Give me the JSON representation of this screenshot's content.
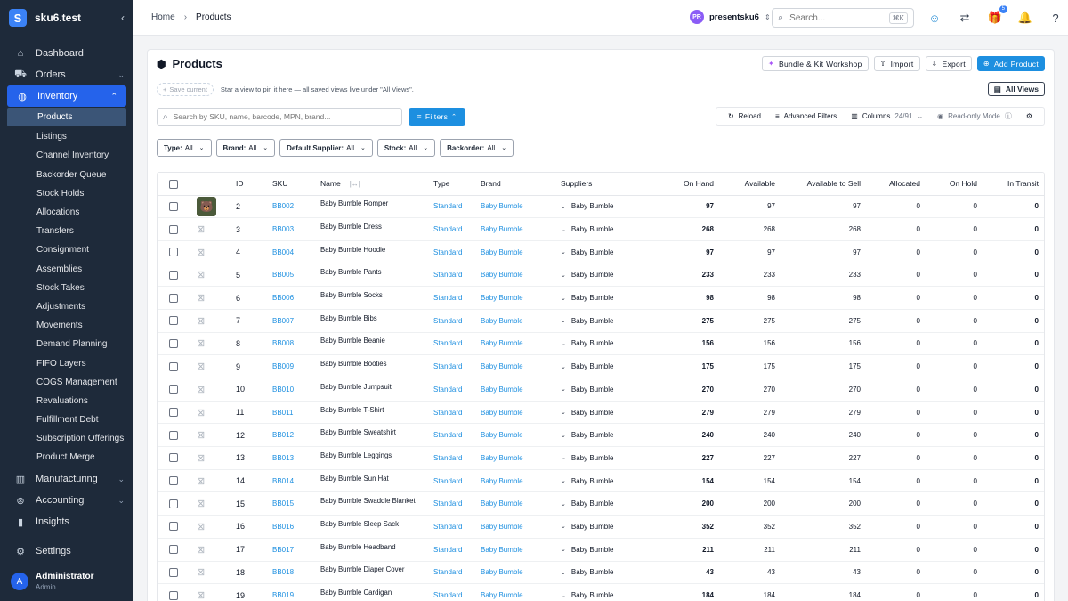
{
  "sidebar": {
    "site": "sku6.test",
    "logo_letter": "S",
    "items": [
      {
        "label": "Dashboard",
        "icon": "dashboard-icon"
      },
      {
        "label": "Orders",
        "icon": "cart-icon",
        "expandable": true
      },
      {
        "label": "Inventory",
        "icon": "globe-icon",
        "expandable": true,
        "active": true
      }
    ],
    "inventory_sub": [
      "Products",
      "Listings",
      "Channel Inventory",
      "Backorder Queue",
      "Stock Holds",
      "Allocations",
      "Transfers",
      "Consignment",
      "Assemblies",
      "Stock Takes",
      "Adjustments",
      "Movements",
      "Demand Planning",
      "FIFO Layers",
      "COGS Management",
      "Revaluations",
      "Fulfillment Debt",
      "Subscription Offerings",
      "Product Merge"
    ],
    "lower_items": [
      {
        "label": "Manufacturing",
        "icon": "factory-icon",
        "expandable": true
      },
      {
        "label": "Accounting",
        "icon": "accounting-icon",
        "expandable": true
      },
      {
        "label": "Insights",
        "icon": "chart-icon"
      }
    ],
    "settings": "Settings",
    "user": {
      "initial": "A",
      "name": "Administrator",
      "role": "Admin"
    }
  },
  "topbar": {
    "breadcrumb": [
      "Home",
      "Products"
    ],
    "workspace": {
      "initials": "PR",
      "name": "presentsku6"
    },
    "search_placeholder": "Search...",
    "shortcut": "⌘K",
    "gift_badge": "5"
  },
  "page": {
    "title": "Products",
    "actions": {
      "bundle": "Bundle & Kit Workshop",
      "import": "Import",
      "export": "Export",
      "add": "Add Product"
    },
    "save_current": "Save current",
    "views_hint": "Star a view to pin it here — all saved views live under \"All Views\".",
    "all_views": "All Views",
    "search_placeholder": "Search by SKU, name, barcode, MPN, brand...",
    "filters": "Filters",
    "reload": "Reload",
    "advanced_filters": "Advanced Filters",
    "columns": "Columns",
    "columns_count": "24/91",
    "read_only": "Read-only Mode",
    "chips": [
      {
        "key": "Type:",
        "value": "All"
      },
      {
        "key": "Brand:",
        "value": "All"
      },
      {
        "key": "Default Supplier:",
        "value": "All"
      },
      {
        "key": "Stock:",
        "value": "All"
      },
      {
        "key": "Backorder:",
        "value": "All"
      }
    ]
  },
  "table": {
    "headers": [
      "ID",
      "SKU",
      "Name",
      "Type",
      "Brand",
      "Suppliers",
      "On Hand",
      "Available",
      "Available to Sell",
      "Allocated",
      "On Hold",
      "In Transit"
    ],
    "rows": [
      {
        "id": "2",
        "sku": "BB002",
        "name": "Baby Bumble Romper",
        "type": "Standard",
        "brand": "Baby Bumble",
        "supplier": "Baby Bumble",
        "on_hand": "97",
        "available": "97",
        "ats": "97",
        "allocated": "0",
        "on_hold": "0",
        "in_transit": "0",
        "has_image": true
      },
      {
        "id": "3",
        "sku": "BB003",
        "name": "Baby Bumble Dress",
        "type": "Standard",
        "brand": "Baby Bumble",
        "supplier": "Baby Bumble",
        "on_hand": "268",
        "available": "268",
        "ats": "268",
        "allocated": "0",
        "on_hold": "0",
        "in_transit": "0"
      },
      {
        "id": "4",
        "sku": "BB004",
        "name": "Baby Bumble Hoodie",
        "type": "Standard",
        "brand": "Baby Bumble",
        "supplier": "Baby Bumble",
        "on_hand": "97",
        "available": "97",
        "ats": "97",
        "allocated": "0",
        "on_hold": "0",
        "in_transit": "0"
      },
      {
        "id": "5",
        "sku": "BB005",
        "name": "Baby Bumble Pants",
        "type": "Standard",
        "brand": "Baby Bumble",
        "supplier": "Baby Bumble",
        "on_hand": "233",
        "available": "233",
        "ats": "233",
        "allocated": "0",
        "on_hold": "0",
        "in_transit": "0"
      },
      {
        "id": "6",
        "sku": "BB006",
        "name": "Baby Bumble Socks",
        "type": "Standard",
        "brand": "Baby Bumble",
        "supplier": "Baby Bumble",
        "on_hand": "98",
        "available": "98",
        "ats": "98",
        "allocated": "0",
        "on_hold": "0",
        "in_transit": "0"
      },
      {
        "id": "7",
        "sku": "BB007",
        "name": "Baby Bumble Bibs",
        "type": "Standard",
        "brand": "Baby Bumble",
        "supplier": "Baby Bumble",
        "on_hand": "275",
        "available": "275",
        "ats": "275",
        "allocated": "0",
        "on_hold": "0",
        "in_transit": "0"
      },
      {
        "id": "8",
        "sku": "BB008",
        "name": "Baby Bumble Beanie",
        "type": "Standard",
        "brand": "Baby Bumble",
        "supplier": "Baby Bumble",
        "on_hand": "156",
        "available": "156",
        "ats": "156",
        "allocated": "0",
        "on_hold": "0",
        "in_transit": "0"
      },
      {
        "id": "9",
        "sku": "BB009",
        "name": "Baby Bumble Booties",
        "type": "Standard",
        "brand": "Baby Bumble",
        "supplier": "Baby Bumble",
        "on_hand": "175",
        "available": "175",
        "ats": "175",
        "allocated": "0",
        "on_hold": "0",
        "in_transit": "0"
      },
      {
        "id": "10",
        "sku": "BB010",
        "name": "Baby Bumble Jumpsuit",
        "type": "Standard",
        "brand": "Baby Bumble",
        "supplier": "Baby Bumble",
        "on_hand": "270",
        "available": "270",
        "ats": "270",
        "allocated": "0",
        "on_hold": "0",
        "in_transit": "0"
      },
      {
        "id": "11",
        "sku": "BB011",
        "name": "Baby Bumble T-Shirt",
        "type": "Standard",
        "brand": "Baby Bumble",
        "supplier": "Baby Bumble",
        "on_hand": "279",
        "available": "279",
        "ats": "279",
        "allocated": "0",
        "on_hold": "0",
        "in_transit": "0"
      },
      {
        "id": "12",
        "sku": "BB012",
        "name": "Baby Bumble Sweatshirt",
        "type": "Standard",
        "brand": "Baby Bumble",
        "supplier": "Baby Bumble",
        "on_hand": "240",
        "available": "240",
        "ats": "240",
        "allocated": "0",
        "on_hold": "0",
        "in_transit": "0"
      },
      {
        "id": "13",
        "sku": "BB013",
        "name": "Baby Bumble Leggings",
        "type": "Standard",
        "brand": "Baby Bumble",
        "supplier": "Baby Bumble",
        "on_hand": "227",
        "available": "227",
        "ats": "227",
        "allocated": "0",
        "on_hold": "0",
        "in_transit": "0"
      },
      {
        "id": "14",
        "sku": "BB014",
        "name": "Baby Bumble Sun Hat",
        "type": "Standard",
        "brand": "Baby Bumble",
        "supplier": "Baby Bumble",
        "on_hand": "154",
        "available": "154",
        "ats": "154",
        "allocated": "0",
        "on_hold": "0",
        "in_transit": "0"
      },
      {
        "id": "15",
        "sku": "BB015",
        "name": "Baby Bumble Swaddle Blanket",
        "type": "Standard",
        "brand": "Baby Bumble",
        "supplier": "Baby Bumble",
        "on_hand": "200",
        "available": "200",
        "ats": "200",
        "allocated": "0",
        "on_hold": "0",
        "in_transit": "0"
      },
      {
        "id": "16",
        "sku": "BB016",
        "name": "Baby Bumble Sleep Sack",
        "type": "Standard",
        "brand": "Baby Bumble",
        "supplier": "Baby Bumble",
        "on_hand": "352",
        "available": "352",
        "ats": "352",
        "allocated": "0",
        "on_hold": "0",
        "in_transit": "0"
      },
      {
        "id": "17",
        "sku": "BB017",
        "name": "Baby Bumble Headband",
        "type": "Standard",
        "brand": "Baby Bumble",
        "supplier": "Baby Bumble",
        "on_hand": "211",
        "available": "211",
        "ats": "211",
        "allocated": "0",
        "on_hold": "0",
        "in_transit": "0"
      },
      {
        "id": "18",
        "sku": "BB018",
        "name": "Baby Bumble Diaper Cover",
        "type": "Standard",
        "brand": "Baby Bumble",
        "supplier": "Baby Bumble",
        "on_hand": "43",
        "available": "43",
        "ats": "43",
        "allocated": "0",
        "on_hold": "0",
        "in_transit": "0"
      },
      {
        "id": "19",
        "sku": "BB019",
        "name": "Baby Bumble Cardigan",
        "type": "Standard",
        "brand": "Baby Bumble",
        "supplier": "Baby Bumble",
        "on_hand": "184",
        "available": "184",
        "ats": "184",
        "allocated": "0",
        "on_hold": "0",
        "in_transit": "0"
      }
    ]
  },
  "colors": {
    "sidebar_bg": "#1e2a3a",
    "accent": "#1d8fe0",
    "active_nav": "#2563eb"
  }
}
